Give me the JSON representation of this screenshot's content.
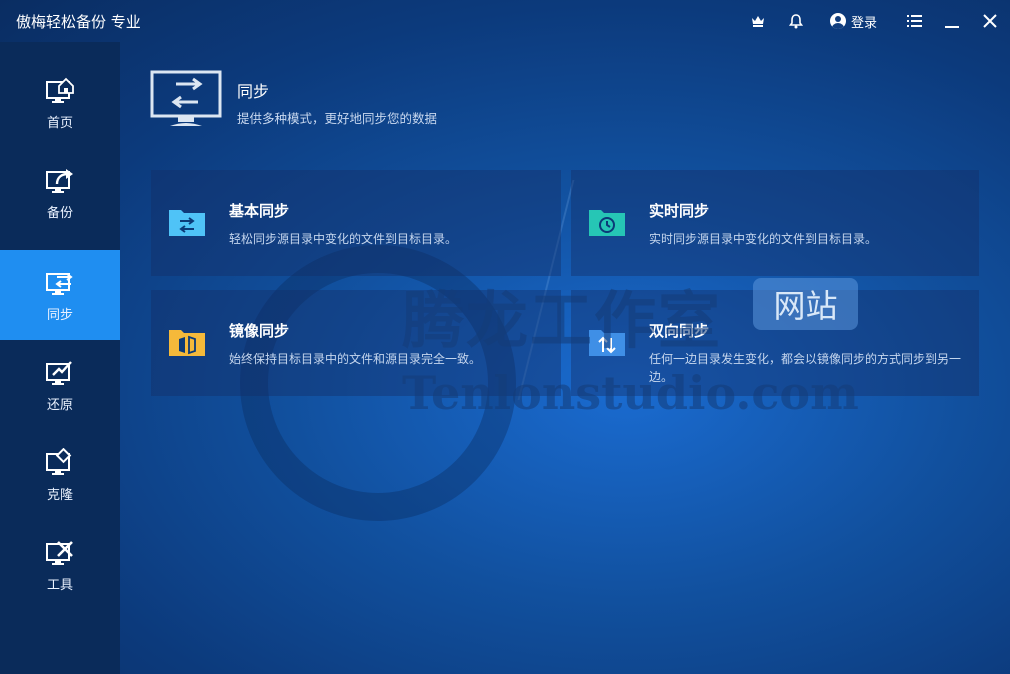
{
  "app": {
    "title": "傲梅轻松备份 专业",
    "login_label": "登录"
  },
  "sidebar": {
    "items": [
      {
        "label": "首页",
        "icon": "home-monitor-icon"
      },
      {
        "label": "备份",
        "icon": "backup-icon"
      },
      {
        "label": "同步",
        "icon": "sync-icon",
        "active": true
      },
      {
        "label": "还原",
        "icon": "restore-icon"
      },
      {
        "label": "克隆",
        "icon": "clone-icon"
      },
      {
        "label": "工具",
        "icon": "tools-icon"
      }
    ]
  },
  "header": {
    "title": "同步",
    "subtitle": "提供多种模式，更好地同步您的数据"
  },
  "options": [
    {
      "title": "基本同步",
      "desc": "轻松同步源目录中变化的文件到目标目录。",
      "icon": "basic-sync-folder-icon",
      "color": "#4fc3f7"
    },
    {
      "title": "实时同步",
      "desc": "实时同步源目录中变化的文件到目标目录。",
      "icon": "realtime-sync-folder-icon",
      "color": "#26c6b5"
    },
    {
      "title": "镜像同步",
      "desc": "始终保持目标目录中的文件和源目录完全一致。",
      "icon": "mirror-sync-folder-icon",
      "color": "#f5b93a"
    },
    {
      "title": "双向同步",
      "desc": "任何一边目录发生变化，都会以镜像同步的方式同步到另一边。",
      "icon": "two-way-sync-folder-icon",
      "color": "#3f8fe6"
    }
  ],
  "watermark": {
    "cn": "腾龙工作室",
    "badge": "网站",
    "en": "Tenlonstudio.com"
  },
  "colors": {
    "accent": "#1f8ef1",
    "sidebar": "#0a2b5a"
  }
}
